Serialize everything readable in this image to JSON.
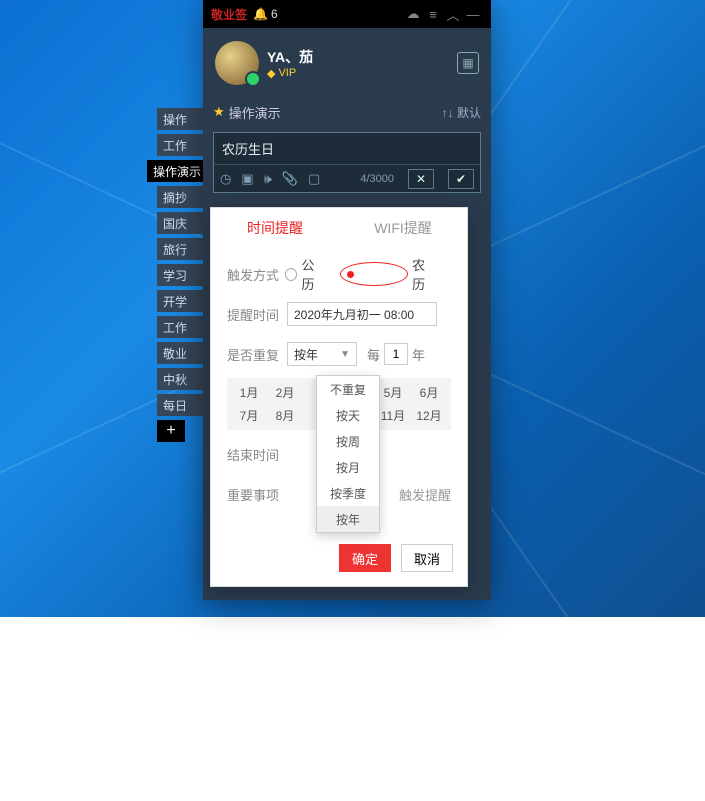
{
  "titlebar": {
    "brand": "敬业签",
    "notif_count": "6"
  },
  "user": {
    "name": "YA、茄",
    "vip": "VIP"
  },
  "category": {
    "name": "操作演示",
    "sort": "↑↓ 默认"
  },
  "note": {
    "text": "农历生日",
    "count": "4/3000"
  },
  "sidetabs": [
    "操作",
    "工作",
    "操作演示",
    "摘抄",
    "国庆",
    "旅行",
    "学习",
    "开学",
    "工作",
    "敬业",
    "中秋",
    "每日"
  ],
  "popover": {
    "tab_time": "时间提醒",
    "tab_wifi": "WIFI提醒",
    "trigger_label": "触发方式",
    "trigger_solar": "公历",
    "trigger_lunar": "农历",
    "remind_label": "提醒时间",
    "remind_value": "2020年九月初一 08:00",
    "repeat_label": "是否重复",
    "repeat_value": "按年",
    "every": "每",
    "every_num": "1",
    "every_unit": "年",
    "months": [
      "1月",
      "2月",
      "5月",
      "6月",
      "7月",
      "8月",
      "11月",
      "12月"
    ],
    "end_label": "结束时间",
    "important_label": "重要事项",
    "important_hint": "触发提醒",
    "ok": "确定",
    "cancel": "取消"
  },
  "dropdown": {
    "options": [
      "不重复",
      "按天",
      "按周",
      "按月",
      "按季度",
      "按年"
    ],
    "selected": "按年"
  }
}
